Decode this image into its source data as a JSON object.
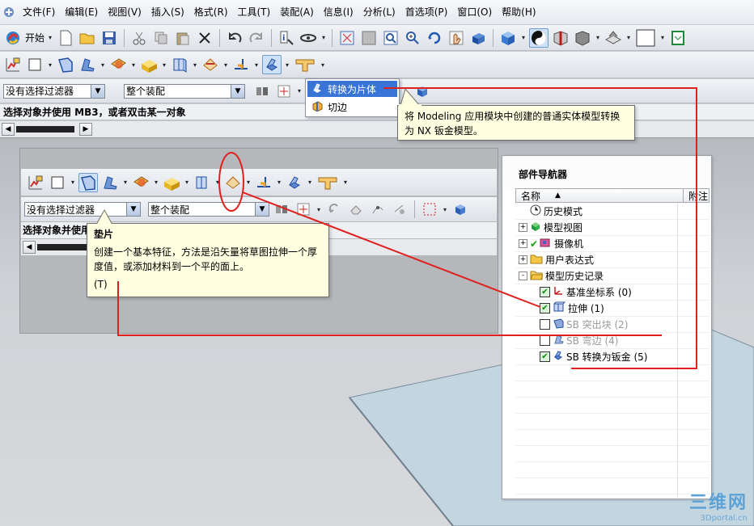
{
  "menubar": {
    "items": [
      "文件(F)",
      "编辑(E)",
      "视图(V)",
      "插入(S)",
      "格式(R)",
      "工具(T)",
      "装配(A)",
      "信息(I)",
      "分析(L)",
      "首选项(P)",
      "窗口(O)",
      "帮助(H)"
    ]
  },
  "toolbar1": {
    "start_label": "开始"
  },
  "selection": {
    "filter": "没有选择过滤器",
    "scope": "整个装配"
  },
  "status": {
    "prompt": "选择对象并使用 MB3，或者双击某一对象"
  },
  "dropdown": {
    "items": [
      {
        "label": "转换为片体",
        "icon": "convert-sheet-icon"
      },
      {
        "label": "切边",
        "icon": "rip-corner-icon"
      }
    ]
  },
  "tooltip_convert": {
    "text": "将 Modeling 应用模块中创建的普通实体模型转换为 NX 钣金模型。"
  },
  "inset": {
    "filter": "没有选择过滤器",
    "scope": "整个装配",
    "prompt_partial": "选择对象并使用M",
    "tooltip": {
      "title": "垫片",
      "body": "创建一个基本特征，方法是沿矢量将草图拉伸一个厚度值，或添加材料到一个平的面上。",
      "shortcut": "(T)"
    }
  },
  "navigator": {
    "title": "部件导航器",
    "col_name": "名称",
    "col_notes": "附注",
    "rows": [
      {
        "label": "历史模式",
        "icon": "clock-icon",
        "indent": 1
      },
      {
        "label": "模型视图",
        "icon": "model-views-icon",
        "expand": "+",
        "indent": 0
      },
      {
        "label": "摄像机",
        "icon": "camera-icon",
        "expand": "+",
        "indent": 0
      },
      {
        "label": "用户表达式",
        "icon": "folder-icon",
        "expand": "+",
        "indent": 0
      },
      {
        "label": "模型历史记录",
        "icon": "folder-open-icon",
        "expand": "-",
        "indent": 0
      },
      {
        "label": "基准坐标系 (0)",
        "icon": "datum-csys-icon",
        "checked": true,
        "indent": 2
      },
      {
        "label": "拉伸 (1)",
        "icon": "extrude-icon",
        "checked": true,
        "indent": 2
      },
      {
        "label": "SB 突出块 (2)",
        "icon": "tab-icon",
        "checked": false,
        "grey": true,
        "indent": 2
      },
      {
        "label": "SB 弯边 (4)",
        "icon": "flange-icon",
        "checked": false,
        "grey": true,
        "indent": 2
      },
      {
        "label": "SB 转换为钣金 (5)",
        "icon": "convert-sheetmetal-icon",
        "checked": true,
        "indent": 2
      }
    ]
  },
  "watermark": {
    "line1": "三维网",
    "line2": "3Dportal.cn"
  },
  "colors": {
    "annotation_red": "#e0201e",
    "highlight_blue": "#3875d7",
    "tooltip_bg": "#ffffe1"
  }
}
